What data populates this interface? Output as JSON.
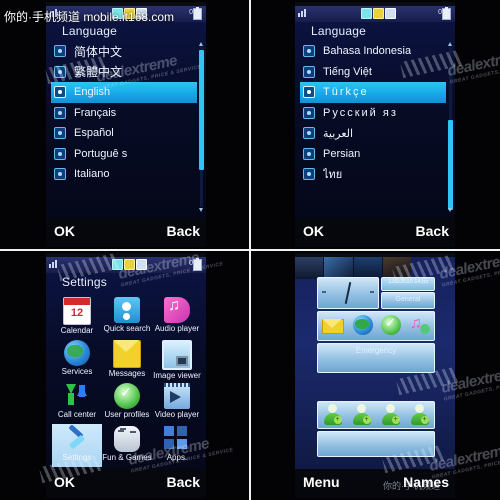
{
  "watermarks": {
    "top": "你的·手机频道 mobile.it168.com",
    "brand": "dealextreme",
    "brand_sub": "GREAT GADGETS, PRICE & SERVICE",
    "bottom_overlay": "你的·手机频道"
  },
  "statusbar": {
    "signal_icon": "signal-bars-icon",
    "icon_1": "sim-card-icon",
    "icon_2": "memory-card-icon",
    "icon_3": "message-icon",
    "battery_level_text": "0",
    "battery_icon": "battery-icon"
  },
  "panels": [
    {
      "id": "panel-language-1",
      "title": "Language",
      "items": [
        {
          "label": "简体中文",
          "selected": false,
          "cjk": true
        },
        {
          "label": "繁體中文",
          "selected": false,
          "cjk": true
        },
        {
          "label": "English",
          "selected": true,
          "cjk": false
        },
        {
          "label": "Français",
          "selected": false,
          "cjk": false
        },
        {
          "label": "Español",
          "selected": false,
          "cjk": false
        },
        {
          "label": "Portuguê s",
          "selected": false,
          "cjk": false
        },
        {
          "label": "Italiano",
          "selected": false,
          "cjk": false
        }
      ],
      "softkey_left": "OK",
      "softkey_right": "Back",
      "scroll": {
        "thumb_top_pct": 2,
        "thumb_height_pct": 72
      }
    },
    {
      "id": "panel-language-2",
      "title": "Language",
      "items": [
        {
          "label": "Bahasa Indonesia",
          "selected": false,
          "cjk": false
        },
        {
          "label": "Tiếng Việt",
          "selected": false,
          "cjk": false
        },
        {
          "label": "Türkçe",
          "selected": true,
          "cjk": false,
          "spaced": true
        },
        {
          "label": "Русский яз",
          "selected": false,
          "cjk": false,
          "spaced": true
        },
        {
          "label": "العربية",
          "selected": false,
          "cjk": false
        },
        {
          "label": "Persian",
          "selected": false,
          "cjk": false
        },
        {
          "label": "ไทย",
          "selected": false,
          "cjk": false
        }
      ],
      "softkey_left": "OK",
      "softkey_right": "Back",
      "scroll": {
        "thumb_top_pct": 45,
        "thumb_height_pct": 53
      }
    }
  ],
  "settings": {
    "title": "Settings",
    "softkey_left": "OK",
    "softkey_right": "Back",
    "items": [
      {
        "label": "Calendar",
        "icon": "calendar-icon",
        "selected": false
      },
      {
        "label": "Quick search",
        "icon": "contacts-icon",
        "selected": false
      },
      {
        "label": "Audio player",
        "icon": "music-note-icon",
        "selected": false
      },
      {
        "label": "Services",
        "icon": "globe-icon",
        "selected": false
      },
      {
        "label": "Messages",
        "icon": "envelope-icon",
        "selected": false
      },
      {
        "label": "Image viewer",
        "icon": "photo-camera-icon",
        "selected": false
      },
      {
        "label": "Call center",
        "icon": "call-arrows-icon",
        "selected": false
      },
      {
        "label": "User profiles",
        "icon": "profile-check-icon",
        "selected": false
      },
      {
        "label": "Video player",
        "icon": "film-play-icon",
        "selected": false
      },
      {
        "label": "Settings",
        "icon": "wrench-screwdriver-icon",
        "selected": true
      },
      {
        "label": "Fun & Games",
        "icon": "gamepad-icon",
        "selected": false
      },
      {
        "label": "Apps.",
        "icon": "app-squares-icon",
        "selected": false
      }
    ]
  },
  "homescreen": {
    "clock_widget": "analog-clock-widget",
    "date_time": "12/2/2010  14:55",
    "profile": "General",
    "profile_icon": "music-note-icon",
    "shortcuts": [
      {
        "name": "messages-shortcut",
        "icon": "envelope-icon"
      },
      {
        "name": "browser-shortcut",
        "icon": "globe-icon"
      },
      {
        "name": "profiles-shortcut",
        "icon": "profile-check-icon"
      },
      {
        "name": "music-shortcut",
        "icon": "music-note-icon"
      }
    ],
    "emergency_label": "Emergency",
    "photos_widget": "photo-strip-widget",
    "contacts_widget": "favorite-contacts-widget",
    "contact_count": 4,
    "softkey_left": "Menu",
    "softkey_right": "Names"
  }
}
